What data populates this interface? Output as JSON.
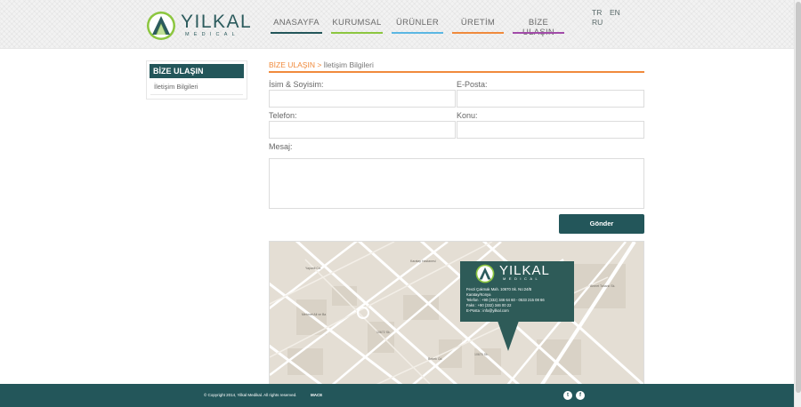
{
  "brand": {
    "name": "YILKAL",
    "sub": "MEDICAL"
  },
  "nav": {
    "items": [
      {
        "label": "ANASAYFA",
        "color": "#23565a"
      },
      {
        "label": "KURUMSAL",
        "color": "#8cc63f"
      },
      {
        "label": "ÜRÜNLER",
        "color": "#5bb7e3"
      },
      {
        "label": "ÜRETİM",
        "color": "#f08a3c"
      },
      {
        "label": "BİZE ULAŞIN",
        "color": "#a24ca9"
      }
    ]
  },
  "languages": [
    "TR",
    "EN",
    "RU"
  ],
  "sidebar": {
    "title": "BİZE ULAŞIN",
    "items": [
      {
        "label": "İletişim Bilgileri"
      }
    ]
  },
  "breadcrumb": {
    "parent": "BİZE ULAŞIN",
    "separator": " > ",
    "current": "İletişim Bilgileri"
  },
  "form": {
    "name_label": "İsim & Soyisim:",
    "email_label": "E-Posta:",
    "phone_label": "Telefon:",
    "subject_label": "Konu:",
    "message_label": "Mesaj:",
    "name_value": "",
    "email_value": "",
    "phone_value": "",
    "subject_value": "",
    "message_value": "",
    "submit_label": "Gönder"
  },
  "map": {
    "card": {
      "name": "YILKAL",
      "sub": "MEDICAL",
      "lines": [
        "Fevzi Çakmak Mah. 10670 Sk. No:24/B",
        "Karatay/Konya",
        "Telefon : +90 (332) 346 64 60 - 0533 215 08 66",
        "Faks : +90 (332) 346 00 22",
        "E-Posta : info@yilkal.com"
      ]
    },
    "labels": [
      "Karatay Hastanesi",
      "Mehmet Ali ve Ba",
      "Yapanli Cd.",
      "10672 Sk.",
      "10670 Sk.",
      "Ahmet Tahanlı Sk.",
      "Bebek Cd."
    ]
  },
  "footer": {
    "copyright": "© Copyright 2014, Yilkal Medikal. All rights reserved.",
    "credit": "MACE",
    "social": [
      {
        "name": "twitter",
        "glyph": "t"
      },
      {
        "name": "facebook",
        "glyph": "f"
      }
    ]
  },
  "colors": {
    "primary": "#23565a",
    "accent": "#f08a3c",
    "logo_green": "#8cc63f"
  }
}
